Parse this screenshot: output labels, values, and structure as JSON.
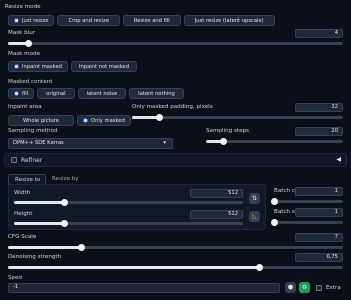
{
  "resize_mode": {
    "label": "Resize mode",
    "options": [
      "Just resize",
      "Crop and resize",
      "Resize and fill",
      "Just resize (latent upscale)"
    ],
    "selected": "Just resize"
  },
  "mask_blur": {
    "label": "Mask blur",
    "value": "4",
    "fraction": 0.06
  },
  "mask_mode": {
    "label": "Mask mode",
    "options": [
      "Inpaint masked",
      "Inpaint not masked"
    ],
    "selected": "Inpaint masked"
  },
  "masked_content": {
    "label": "Masked content",
    "options": [
      "fill",
      "original",
      "latent noise",
      "latent nothing"
    ],
    "selected": "fill"
  },
  "inpaint_area": {
    "label": "Inpaint area",
    "options": [
      "Whole picture",
      "Only masked"
    ],
    "selected": "Only masked"
  },
  "padding": {
    "label": "Only masked padding, pixels",
    "value": "32",
    "fraction": 0.13
  },
  "sampling_method": {
    "label": "Sampling method",
    "value": "DPM++ SDE Karras"
  },
  "sampling_steps": {
    "label": "Sampling steps",
    "value": "20",
    "fraction": 0.13
  },
  "refiner": {
    "label": "Refiner",
    "collapse_icon": "triangle-left-icon"
  },
  "tabs": {
    "active": "Resize to",
    "other": "Resize by"
  },
  "width": {
    "label": "Width",
    "value": "512",
    "fraction": 0.22
  },
  "height": {
    "label": "Height",
    "value": "512",
    "fraction": 0.22
  },
  "swap_icon": "swap-arrows-icon",
  "ratio_icon": "aspect-ratio-icon",
  "batch_count": {
    "label": "Batch count",
    "value": "1",
    "fraction": 0.0
  },
  "batch_size": {
    "label": "Batch size",
    "value": "1",
    "fraction": 0.0
  },
  "cfg_scale": {
    "label": "CFG Scale",
    "value": "7",
    "fraction": 0.22
  },
  "denoising": {
    "label": "Denoising strength",
    "value": "0,75",
    "fraction": 0.75
  },
  "seed": {
    "label": "Seed",
    "value": "-1",
    "dice_icon": "dice-icon",
    "recycle_icon": "recycle-icon",
    "extra_label": "Extra"
  },
  "colors": {
    "background": "#0b0f19",
    "accent": "#2563eb",
    "green": "#16a34a",
    "orange": "#f59e0b"
  }
}
